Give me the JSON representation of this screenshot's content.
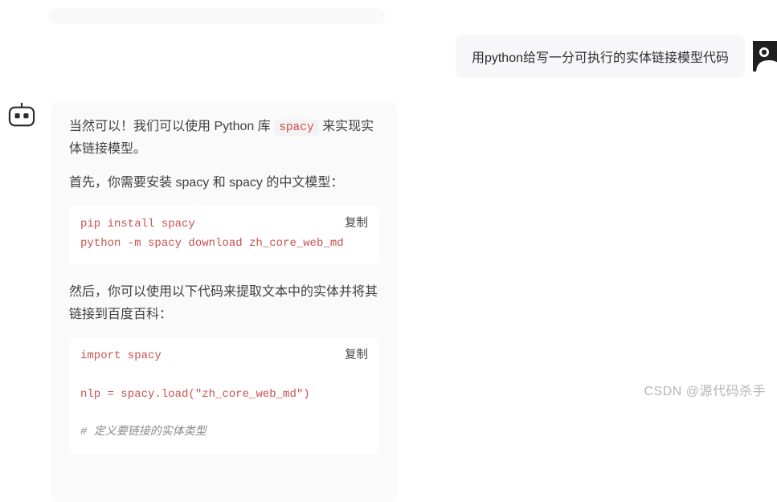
{
  "user": {
    "message": "用python给写一分可执行的实体链接模型代码"
  },
  "bot": {
    "intro_before": "当然可以！我们可以使用 Python 库 ",
    "intro_code": "spacy",
    "intro_after": " 来实现实体链接模型。",
    "step1": "首先，你需要安装 spacy 和 spacy 的中文模型：",
    "code1": {
      "text": "pip install spacy\npython -m spacy download zh_core_web_md",
      "copy_label": "复制"
    },
    "step2": "然后，你可以使用以下代码来提取文本中的实体并将其链接到百度百科：",
    "code2": {
      "line1": "import spacy",
      "line2a": "nlp = spacy.load(",
      "line2b": "\"zh_core_web_md\"",
      "line2c": ")",
      "line3": "# 定义要链接的实体类型",
      "copy_label": "复制"
    }
  },
  "watermark": "CSDN @源代码杀手"
}
